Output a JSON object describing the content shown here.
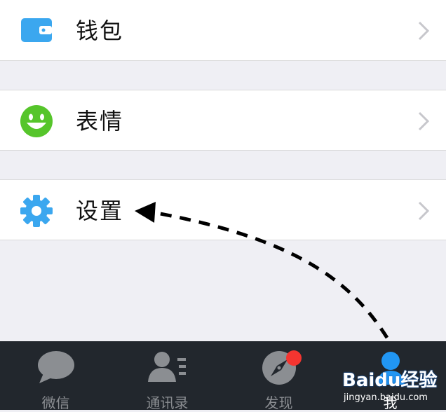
{
  "menu": {
    "items": [
      {
        "label": "钱包",
        "icon": "wallet-icon",
        "icon_color": "#3ba7ef"
      },
      {
        "label": "表情",
        "icon": "smiley-icon",
        "icon_color": "#56c52b"
      },
      {
        "label": "设置",
        "icon": "gear-icon",
        "icon_color": "#3ba7ef"
      }
    ]
  },
  "tabbar": {
    "tabs": [
      {
        "label": "微信",
        "icon": "chat-bubble-icon",
        "active": false
      },
      {
        "label": "通讯录",
        "icon": "contacts-icon",
        "active": false
      },
      {
        "label": "发现",
        "icon": "compass-icon",
        "active": false,
        "badge": "red-dot"
      },
      {
        "label": "我",
        "icon": "person-icon",
        "active": true
      }
    ],
    "active_color": "#2196f3",
    "inactive_color": "#8b8e92",
    "badge_color": "#f43530"
  },
  "annotation": {
    "type": "dashed-arrow",
    "points_to": "设置"
  },
  "watermark": {
    "brand": "Baidu经验",
    "url": "jingyan.baidu.com"
  }
}
